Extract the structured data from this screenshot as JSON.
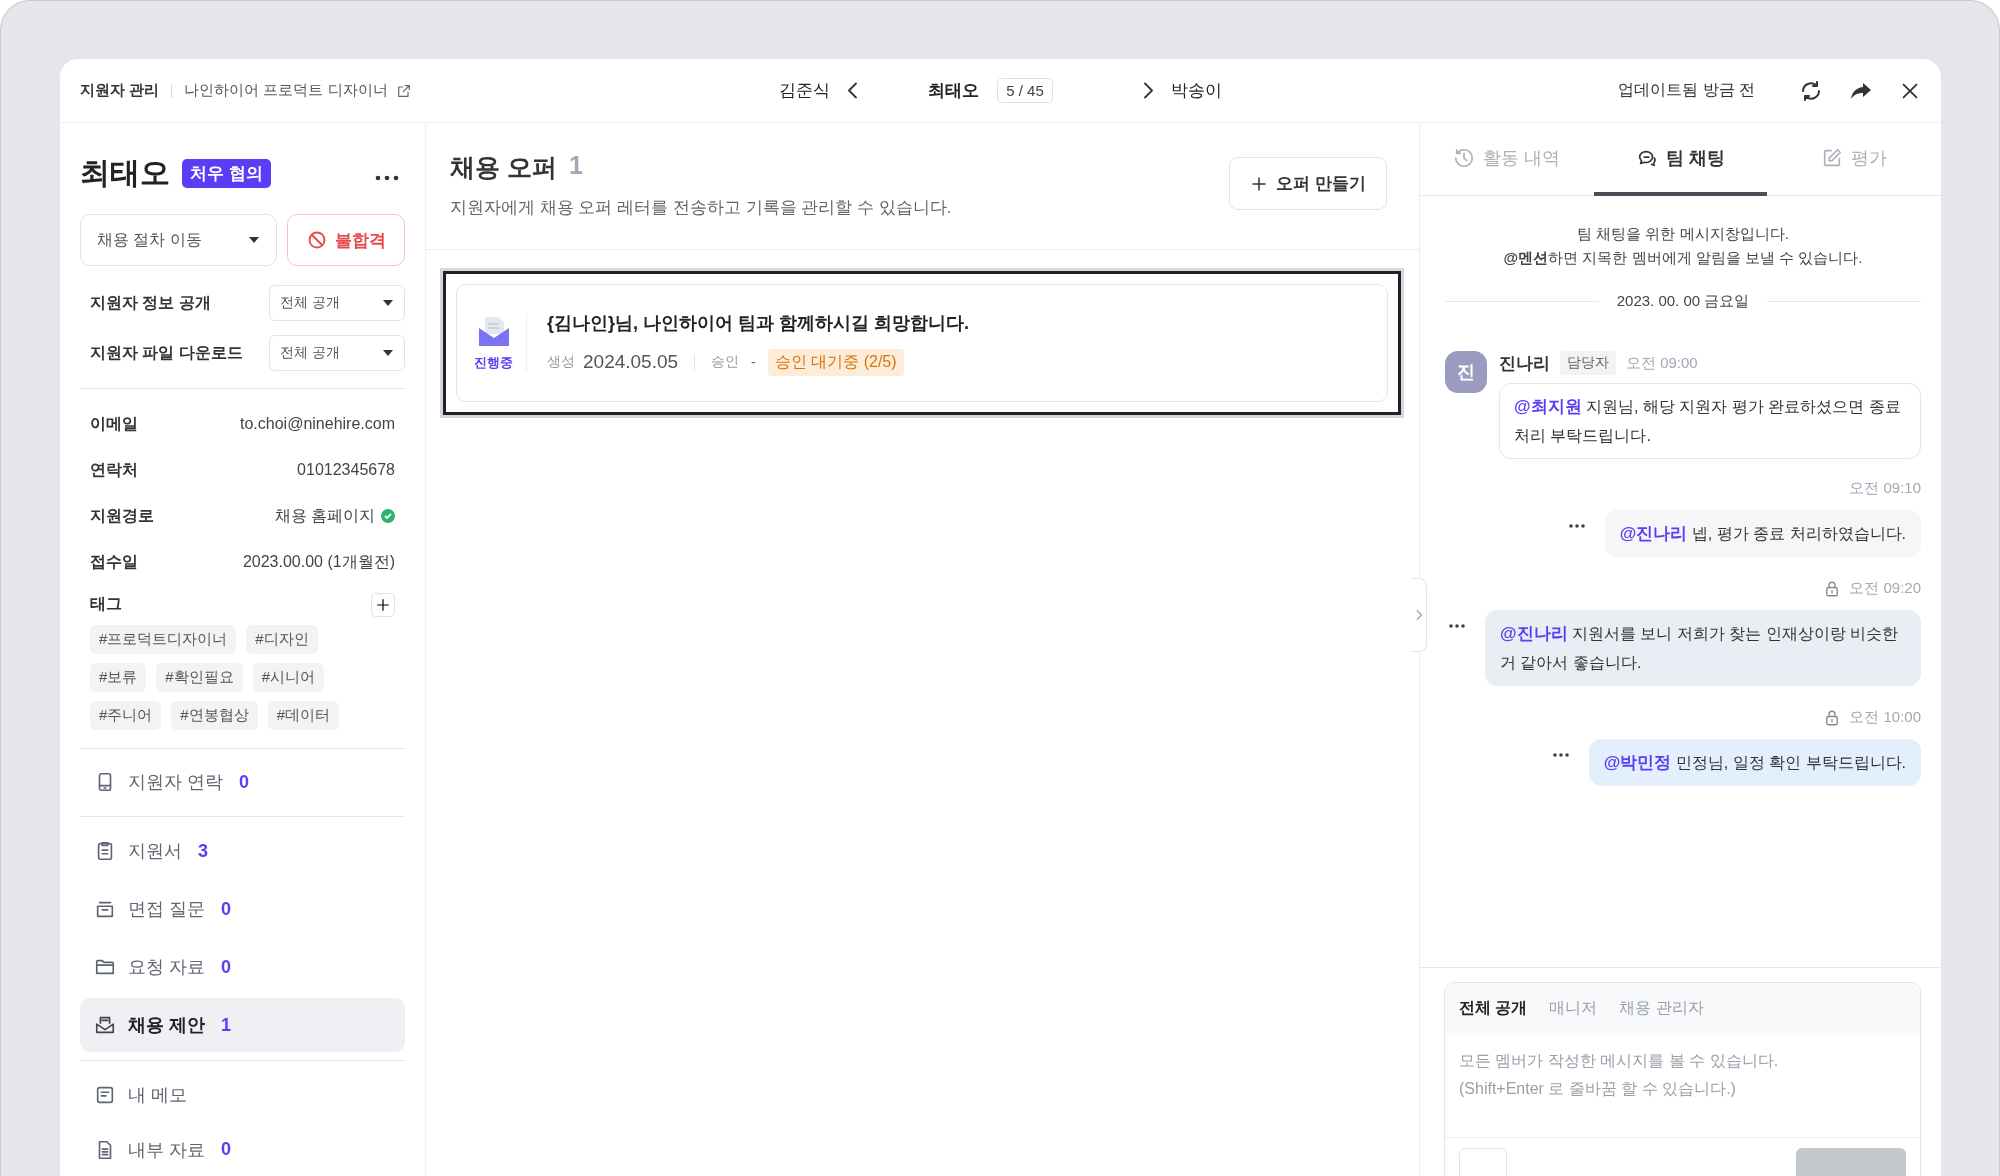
{
  "top_bar": {
    "breadcrumb": "지원자 관리",
    "job": "나인하이어 프로덕트 디자이너",
    "prev": "김준식",
    "current": "최태오",
    "position": "5 / 45",
    "next": "박송이",
    "updated": "업데이트됨 방금 전"
  },
  "candidate": {
    "name": "최태오",
    "stage_badge": "처우 협의",
    "stage_select": "채용 절차 이동",
    "reject_button": "불합격",
    "settings": [
      {
        "label": "지원자 정보 공개",
        "value": "전체 공개"
      },
      {
        "label": "지원자 파일 다운로드",
        "value": "전체 공개"
      }
    ],
    "info": [
      {
        "label": "이메일",
        "value": "to.choi@ninehire.com",
        "verified": false
      },
      {
        "label": "연락처",
        "value": "01012345678",
        "verified": false
      },
      {
        "label": "지원경로",
        "value": "채용 홈페이지",
        "verified": true
      },
      {
        "label": "접수일",
        "value": "2023.00.00 (1개월전)",
        "verified": false
      }
    ],
    "tags_label": "태그",
    "tags": [
      "#프로덕트디자이너",
      "#디자인",
      "#보류",
      "#확인필요",
      "#시니어",
      "#주니어",
      "#연봉협상",
      "#데이터"
    ],
    "nav_groups": [
      [
        {
          "label": "지원자 연락",
          "count": "0",
          "selected": false
        }
      ],
      [
        {
          "label": "지원서",
          "count": "3",
          "selected": false
        },
        {
          "label": "면접 질문",
          "count": "0",
          "selected": false
        },
        {
          "label": "요청 자료",
          "count": "0",
          "selected": false
        },
        {
          "label": "채용 제안",
          "count": "1",
          "selected": true
        }
      ],
      [
        {
          "label": "내 메모",
          "selected": false
        },
        {
          "label": "내부 자료",
          "count": "0",
          "selected": false
        }
      ]
    ]
  },
  "offers": {
    "title": "채용 오퍼",
    "count": "1",
    "subtitle": "지원자에게 채용 오퍼 레터를 전송하고 기록을 관리할 수 있습니다.",
    "create_button": "오퍼 만들기",
    "items": [
      {
        "status": "진행중",
        "title": "{김나인}님, 나인하이어 팀과 함께하시길 희망합니다.",
        "created_label": "생성",
        "created": "2024.05.05",
        "approval_label": "승인",
        "approval": "-",
        "approval_status": "승인 대기중 (2/5)",
        "selected": true
      }
    ]
  },
  "chat": {
    "tabs": [
      {
        "label": "활동 내역",
        "selected": false
      },
      {
        "label": "팀 채팅",
        "selected": true
      },
      {
        "label": "평가",
        "selected": false
      }
    ],
    "intro": [
      "팀 채팅을 위한 메시지창입니다.",
      "**@멘션**하면 지목한 멤버에게 알림을 보낼 수 있습니다."
    ],
    "date": "2023. 00. 00 금요일",
    "messages": [
      {
        "kind": "received",
        "avatar": "진",
        "author": "진나리",
        "role": "담당자",
        "time": "오전 09:00",
        "text": "**@최지원** 지원님, 해당 지원자 평가 완료하셨으면 종료 처리 부탁드립니다.",
        "locked": false
      },
      {
        "kind": "all",
        "time": "오전 09:10",
        "text": "**@진나리** 넵, 평가 종료 처리하였습니다.",
        "locked": false
      },
      {
        "kind": "manager",
        "time": "오전 09:20",
        "text": "**@진나리** 지원서를 보니 저희가 찾는 인재상이랑 비슷한 거 같아서 좋습니다.",
        "locked": true
      },
      {
        "kind": "admin",
        "time": "오전 10:00",
        "text": "**@박민정** 민정님, 일정 확인 부탁드립니다.",
        "locked": true
      }
    ],
    "composer": {
      "tabs": [
        {
          "label": "전체 공개",
          "selected": true
        },
        {
          "label": "매니저",
          "selected": false
        },
        {
          "label": "채용 관리자",
          "selected": false
        }
      ],
      "placeholder": "모든 멤버가 작성한 메시지를 볼 수 있습니다.\n(Shift+Enter 로 줄바꿈 할 수 있습니다.)"
    }
  }
}
